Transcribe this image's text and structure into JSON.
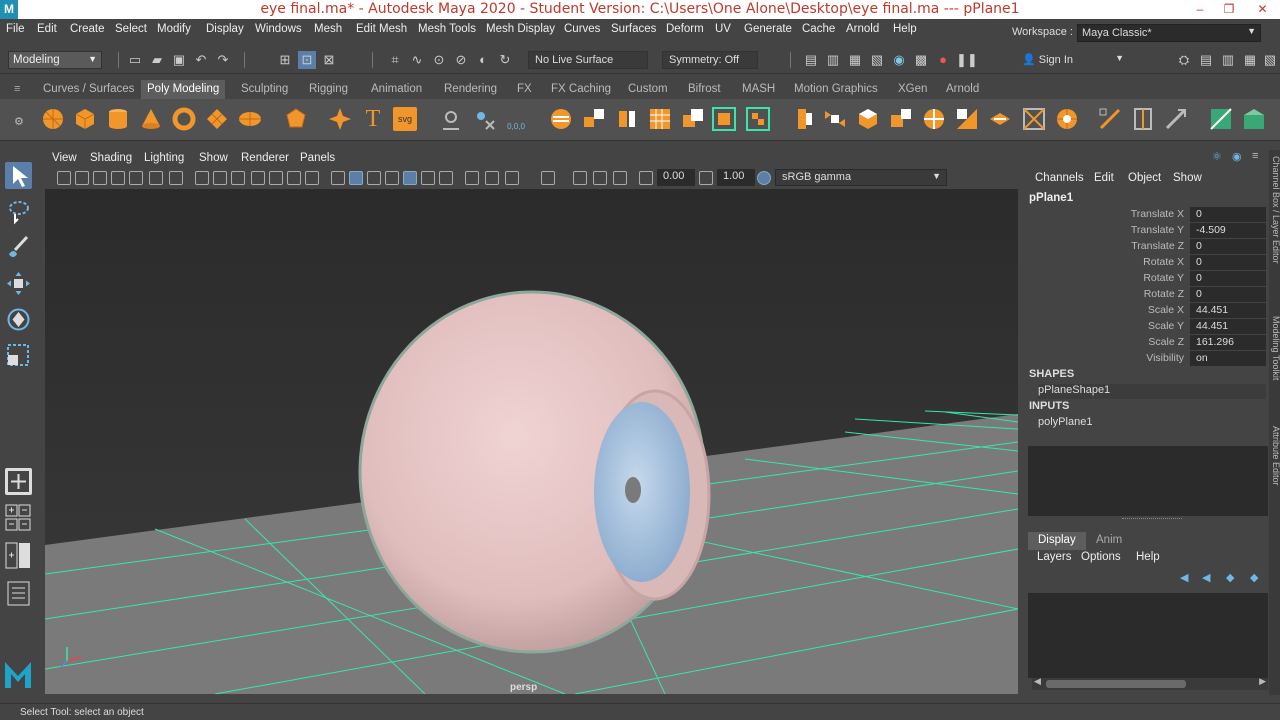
{
  "window": {
    "title": "eye final.ma* - Autodesk Maya 2020 - Student Version: C:\\Users\\One Alone\\Desktop\\eye final.ma   ---   pPlane1",
    "logo_letter": "M",
    "minimize": "–",
    "restore": "❐"
  },
  "menubar": {
    "items": [
      "File",
      "Edit",
      "Create",
      "Select",
      "Modify",
      "Display",
      "Windows",
      "Mesh",
      "Edit Mesh",
      "Mesh Tools",
      "Mesh Display",
      "Curves",
      "Surfaces",
      "Deform",
      "UV",
      "Generate",
      "Cache",
      "Arnold",
      "Help"
    ],
    "workspace_label": "Workspace :",
    "workspace_value": "Maya Classic*"
  },
  "statusline": {
    "mode": "Modeling",
    "live_surface": "No Live Surface",
    "symmetry": "Symmetry: Off",
    "sign_in": "Sign In"
  },
  "shelf": {
    "tabs": [
      "Curves / Surfaces",
      "Poly Modeling",
      "Sculpting",
      "Rigging",
      "Animation",
      "Rendering",
      "FX",
      "FX Caching",
      "Custom",
      "Bifrost",
      "MASH",
      "Motion Graphics",
      "XGen",
      "Arnold"
    ],
    "active_tab": "Poly Modeling",
    "text_icon": "T",
    "svg_icon": "svg",
    "coord_icon": "0,0,0"
  },
  "viewport": {
    "menu": [
      "View",
      "Shading",
      "Lighting",
      "Show",
      "Renderer",
      "Panels"
    ],
    "near_value": "0.00",
    "far_value": "1.00",
    "color_space": "sRGB gamma",
    "camera": "persp"
  },
  "channelbox": {
    "menu": [
      "Channels",
      "Edit",
      "Object",
      "Show"
    ],
    "object": "pPlane1",
    "attributes": [
      {
        "name": "Translate X",
        "value": "0"
      },
      {
        "name": "Translate Y",
        "value": "-4.509"
      },
      {
        "name": "Translate Z",
        "value": "0"
      },
      {
        "name": "Rotate X",
        "value": "0"
      },
      {
        "name": "Rotate Y",
        "value": "0"
      },
      {
        "name": "Rotate Z",
        "value": "0"
      },
      {
        "name": "Scale X",
        "value": "44.451"
      },
      {
        "name": "Scale Y",
        "value": "44.451"
      },
      {
        "name": "Scale Z",
        "value": "161.296"
      },
      {
        "name": "Visibility",
        "value": "on"
      }
    ],
    "shapes_label": "SHAPES",
    "shape": "pPlaneShape1",
    "inputs_label": "INPUTS",
    "input": "polyPlane1"
  },
  "layers": {
    "tabs": [
      "Display",
      "Anim"
    ],
    "menu": [
      "Layers",
      "Options",
      "Help"
    ]
  },
  "side_strip": [
    "Channel Box / Layer Editor",
    "Modeling Toolkit",
    "Attribute Editor"
  ],
  "help_line": "Select Tool: select an object",
  "colors": {
    "ui_bg": "#444444",
    "viewport_top": "#2f2f2f",
    "ground": "#7c7c7c",
    "grid": "#39e6a8",
    "eyeball": "#e8c9c9",
    "iris": "#a6c4e0",
    "accent_blue": "#5b7fa8",
    "shelf_orange": "#f0962b"
  }
}
